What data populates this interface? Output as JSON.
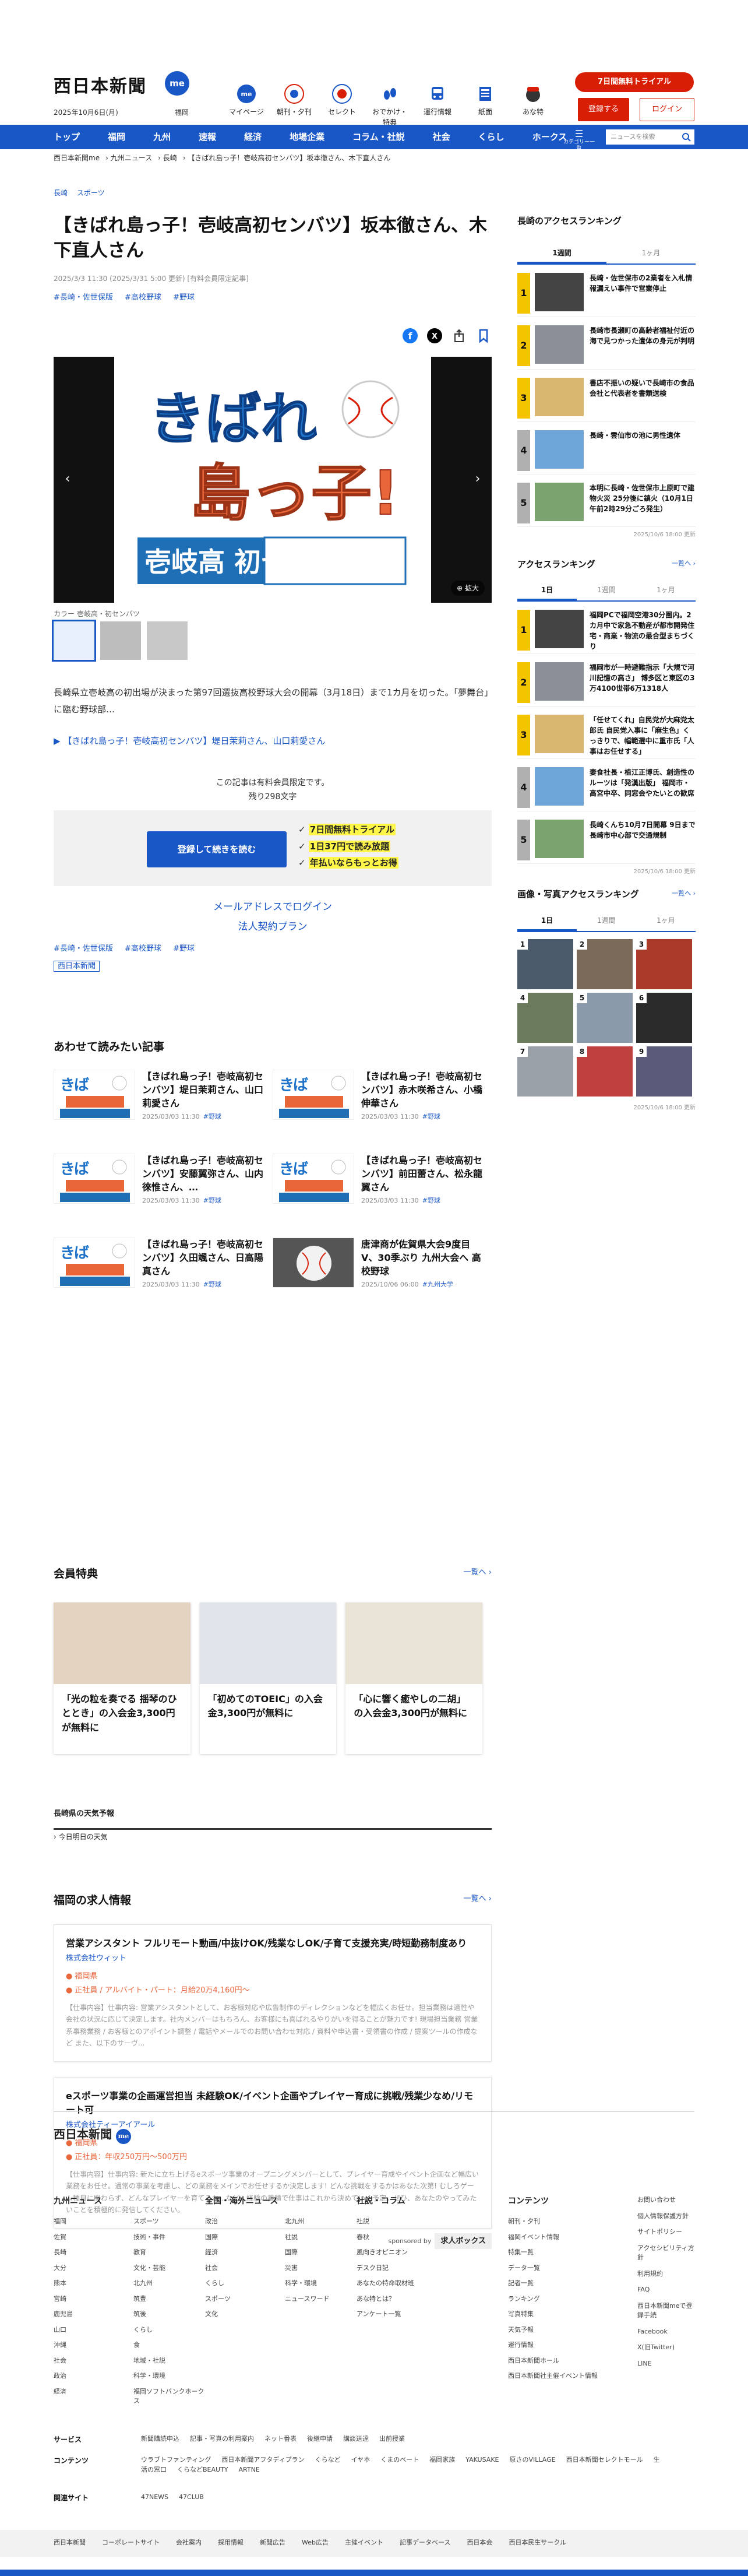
{
  "header": {
    "logo": "西日本新聞",
    "logo_me": "me",
    "date": "2025年10月6日(月)",
    "city": "福岡",
    "nav_icons": [
      {
        "label": "マイページ",
        "icon": "me-icon"
      },
      {
        "label": "朝刊・夕刊",
        "icon": "newspaper-icon"
      },
      {
        "label": "セレクト",
        "icon": "select-icon"
      },
      {
        "label": "おでかけ・特典",
        "icon": "coupon-icon"
      },
      {
        "label": "運行情報",
        "icon": "train-icon"
      },
      {
        "label": "紙面",
        "icon": "paper-icon"
      },
      {
        "label": "あな特",
        "icon": "police-icon"
      }
    ],
    "trial": "7日間無料トライアル",
    "register": "登録する",
    "login": "ログイン"
  },
  "gnav": {
    "items": [
      "トップ",
      "福岡",
      "九州",
      "速報",
      "経済",
      "地場企業",
      "コラム・社説",
      "社会",
      "くらし",
      "ホークス"
    ],
    "more": "カテゴリー一覧",
    "search_placeholder": "ニュースを検索"
  },
  "breadcrumb": [
    "西日本新聞me",
    "九州ニュース",
    "長崎",
    "【きばれ島っ子！壱岐高初センバツ】坂本徹さん、木下直人さん"
  ],
  "article": {
    "categories": [
      "長崎",
      "スポーツ"
    ],
    "title": "【きばれ島っ子！壱岐高初センバツ】坂本徹さん、木下直人さん",
    "meta": "2025/3/3 11:30 (2025/3/31 5:00 更新) [有料会員限定記事]",
    "tags": [
      "#長崎・佐世保版",
      "#高校野球",
      "#野球"
    ],
    "hero_text_1": "きばれ",
    "hero_text_2": "島っ子!",
    "hero_text_3": "壱岐高 初センバツ",
    "enlarge": "拡大",
    "caption": "カラー 壱岐高・初センバツ",
    "lead": "長崎県立壱岐高の初出場が決まった第97回選抜高校野球大会の開幕（3月18日）まで1カ月を切った。「夢舞台」に臨む野球部…",
    "lead_link": "【きばれ島っ子！壱岐高初センバツ】堤日茉莉さん、山口莉愛さん",
    "member_only": "この記事は有料会員限定です。",
    "remaining": "残り298文字",
    "pay_button": "登録して続きを読む",
    "benefits": [
      "7日間無料トライアル",
      "1日37円で読み放題",
      "年払いならもっとお得"
    ],
    "mail_login": "メールアドレスでログイン",
    "plan": "法人契約プラン",
    "tags2": [
      "#長崎・佐世保版",
      "#高校野球",
      "#野球"
    ],
    "source": "西日本新聞"
  },
  "related": {
    "heading": "あわせて読みたい記事",
    "items": [
      {
        "title": "【きばれ島っ子！壱岐高初センバツ】堤日茉莉さん、山口莉愛さん",
        "date": "2025/03/03 11:30",
        "tag": "#野球"
      },
      {
        "title": "【きばれ島っ子！壱岐高初センバツ】赤木咲希さん、小橋伸華さん",
        "date": "2025/03/03 11:30",
        "tag": "#野球"
      },
      {
        "title": "【きばれ島っ子！壱岐高初センバツ】安藤翼弥さん、山内徠惟さん、…",
        "date": "2025/03/03 11:30",
        "tag": "#野球"
      },
      {
        "title": "【きばれ島っ子！壱岐高初センバツ】前田蕾さん、松永龍翼さん",
        "date": "2025/03/03 11:30",
        "tag": "#野球"
      },
      {
        "title": "【きばれ島っ子！壱岐高初センバツ】久田颯さん、日高陽真さん",
        "date": "2025/03/03 11:30",
        "tag": "#野球"
      },
      {
        "title": "唐津商が佐賀県大会9度目V、30季ぶり 九州大会へ 高校野球",
        "date": "2025/10/06 06:00",
        "tag": "#九州大学"
      }
    ]
  },
  "perks": {
    "heading": "会員特典",
    "more": "一覧へ",
    "items": [
      "「光の粒を奏でる 揺琴のひととき」の入会金3,300円が無料に",
      "「初めてのTOEIC」の入会金3,300円が無料に",
      "「心に響く癒やしの二胡」の入会金3,300円が無料に"
    ]
  },
  "weather": {
    "heading": "長崎県の天気予報",
    "sub": "今日明日の天気"
  },
  "jobs": {
    "heading": "福岡の求人情報",
    "more": "一覧へ",
    "items": [
      {
        "title": "営業アシスタント フルリモート動画/中抜けOK/残業なしOK/子育て支援充実/時短勤務制度あり",
        "company": "株式会社ウィット",
        "location": "福岡県",
        "pay": "正社員 / アルバイト・パート：月給20万4,160円～",
        "desc": "【仕事内容】仕事内容: 営業アシスタントとして、お客様対応や広告制作のディレクションなどを幅広くお任せ。担当業務は適性や会社の状況に応じて決定します。社内メンバーはもちろん、お客様にも喜ばれるやりがいを得ることが魅力です! 現場担当業務 営業系事務業務 / お客様とのアポイント調整 / 電話やメールでのお問い合わせ対応 / 資料や申込書・受領書の作成 / 提案ツールの作成など また、以下のサーヴ..."
      },
      {
        "title": "eスポーツ事業の企画運営担当 未経験OK/イベント企画やプレイヤー育成に挑戦/残業少なめ/リモート可",
        "company": "株式会社ティーアイアール",
        "location": "福岡県",
        "pay": "正社員：年収250万円～500万円",
        "desc": "【仕事内容】仕事内容: 新たに立ち上げるeスポーツ事業のオープニングメンバーとして、プレイヤー育成やイベント企画など幅広い業務をお任せ。通常の事業を考慮し、どの業務をメインでお任せするか決定します! どんな挑戦をするかはあなた次第! むしろゲーム種目に関わらず、どんなプレイヤーを育てるか…など、経験の蓄積で仕事はこれから決めていく予定。ぜひ、あなたのやってみたいことを積極的に発信してください。"
      }
    ],
    "sponsor_label": "sponsored by",
    "sponsor": "求人ボックス"
  },
  "sidebar": {
    "access": {
      "heading": "長崎のアクセスランキング",
      "tabs": [
        "1週間",
        "1ヶ月"
      ],
      "items": [
        "長崎・佐世保市の2業者を入札情報漏えい事件で営業停止",
        "長崎市長瀬町の高齢者福祉付近の海で見つかった遺体の身元が判明",
        "書店不振いの疑いで長崎市の食品会社と代表者を書類送検",
        "長崎・雲仙市の池に男性遺体",
        "本明に長崎・佐世保市上原町で建物火災 25分後に鎮火（10月1日午前2時29分ごろ発生）"
      ],
      "updated": "2025/10/6 18:00 更新"
    },
    "access_all": {
      "heading": "アクセスランキング",
      "more": "一覧へ",
      "tabs": [
        "1日",
        "1週間",
        "1ヶ月"
      ],
      "items": [
        "福岡PCで福岡空港30分圏内。2カ月中で家急不動産が都市開発住宅・商業・物流の最合型まちづくり",
        "福岡市が一時避難指示「大規で河川記憶の高さ」 博多区と東区の3万4100世帯6万1318人",
        "「任せてくれ」自民党が大麻党太郎氏 自民党入事に「麻生色」くっきりで、幅範選中に重市氏「人事はお任せする」",
        "妻食社長・植江正博氏、創造性のルーツは「発漢出版」 福岡市・高宮中卒、同窓会やたいとの歓席",
        "長崎くんち10月7日開幕 9日まで長崎市中心部で交通規制"
      ],
      "updated": "2025/10/6 18:00 更新"
    },
    "photo": {
      "heading": "画像・写真アクセスランキング",
      "more": "一覧へ",
      "tabs": [
        "1日",
        "1週間",
        "1ヶ月"
      ],
      "numbers": [
        "1",
        "2",
        "3",
        "4",
        "5",
        "6",
        "7",
        "8",
        "9"
      ],
      "updated": "2025/10/6 18:00 更新"
    }
  },
  "footer": {
    "logo": "西日本新聞",
    "cols": [
      {
        "heading": "九州ニュース",
        "items": [
          "福岡",
          "佐賀",
          "長崎",
          "大分",
          "熊本",
          "宮崎",
          "鹿児島",
          "山口",
          "沖縄",
          "社会",
          "政治",
          "経済",
          "スポーツ",
          "技術・事件",
          "教育",
          "文化・芸能",
          "北九州",
          "筑豊",
          "筑後",
          "くらし",
          "食",
          "地域・社説",
          "科学・環境",
          "福岡ソフトバンクホークス"
        ]
      },
      {
        "heading": "全国・海外ニュース",
        "items": [
          "政治",
          "国際",
          "経済",
          "社会",
          "くらし",
          "スポーツ",
          "文化",
          "北九州",
          "社説",
          "国際",
          "災害",
          "科学・環境",
          "ニュースワード"
        ]
      },
      {
        "heading": "社説・コラム",
        "items": [
          "社説",
          "春秋",
          "風向きオピニオン",
          "デスク日記",
          "あなたの特命取材班",
          "あな特とは？",
          "アンケート一覧"
        ]
      },
      {
        "heading": "コンテンツ",
        "items": [
          "朝刊・夕刊",
          "福岡イベント情報",
          "特集一覧",
          "データ一覧",
          "記者一覧",
          "ランキング",
          "写真特集",
          "天気予報",
          "運行情報",
          "西日本新聞ホール",
          "西日本新聞社主催イベント情報"
        ]
      }
    ],
    "small": [
      "お問い合わせ",
      "個人情報保護方針",
      "サイトポリシー",
      "アクセシビリティ方針",
      "利用規約",
      "FAQ",
      "西日本新聞meで登録手続",
      "Facebook",
      "X(旧Twitter)",
      "LINE"
    ],
    "services_label": "サービス",
    "services": [
      "新聞購読申込",
      "記事・写真の利用案内",
      "ネット番表",
      "後継申請",
      "講談送達",
      "出前授業"
    ],
    "contents_label": "コンテンツ",
    "contents": [
      "ウラブトファンティング",
      "西日本新聞アフタディプラン",
      "くらなど",
      "イヤホ",
      "くまのベート",
      "福岡家族",
      "YAKUSAKE",
      "原さのVILLAGE",
      "西日本新聞セレクトモール",
      "生活の窓口",
      "くらなどBEAUTY",
      "ARTNE"
    ],
    "related_label": "関連サイト",
    "related": [
      "47NEWS",
      "47CLUB"
    ],
    "bottom": [
      "西日本新聞",
      "コーポレートサイト",
      "会社案内",
      "採用情報",
      "新聞広告",
      "Web広告",
      "主催イベント",
      "記事データベース",
      "西日本会",
      "西日本民生サークル"
    ]
  }
}
